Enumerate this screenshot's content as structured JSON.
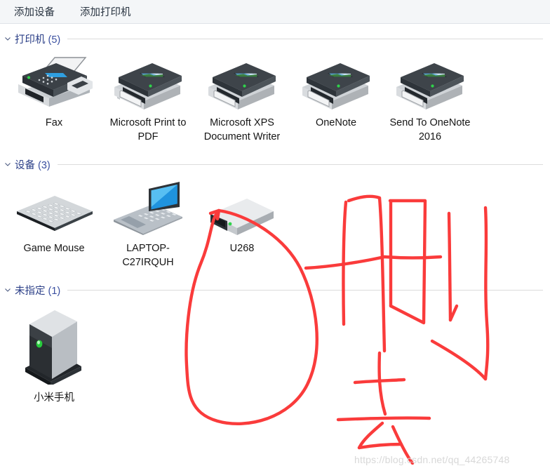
{
  "toolbar": {
    "buttons": [
      {
        "label": "添加设备",
        "name": "add-device-button"
      },
      {
        "label": "添加打印机",
        "name": "add-printer-button"
      }
    ]
  },
  "sections": [
    {
      "id": "printers",
      "title": "打印机",
      "count": "(5)",
      "items": [
        {
          "label": "Fax",
          "icon": "fax-icon"
        },
        {
          "label": "Microsoft Print to PDF",
          "icon": "printer-icon"
        },
        {
          "label": "Microsoft XPS Document Writer",
          "icon": "printer-icon"
        },
        {
          "label": "OneNote",
          "icon": "printer-icon"
        },
        {
          "label": "Send To OneNote 2016",
          "icon": "printer-icon"
        }
      ]
    },
    {
      "id": "devices",
      "title": "设备",
      "count": "(3)",
      "items": [
        {
          "label": "Game Mouse",
          "icon": "keyboard-icon"
        },
        {
          "label": "LAPTOP-C27IRQUH",
          "icon": "laptop-icon"
        },
        {
          "label": "U268",
          "icon": "usb-drive-icon"
        }
      ]
    },
    {
      "id": "unspec",
      "title": "未指定",
      "count": "(1)",
      "items": [
        {
          "label": "小米手机",
          "icon": "generic-device-icon"
        }
      ]
    }
  ],
  "annotation": {
    "color": "#fa3b3b",
    "note": "手写红色批注：圈出 U268 并写字"
  },
  "watermark": {
    "text": "https://blog.csdn.net/qq_44265748"
  }
}
